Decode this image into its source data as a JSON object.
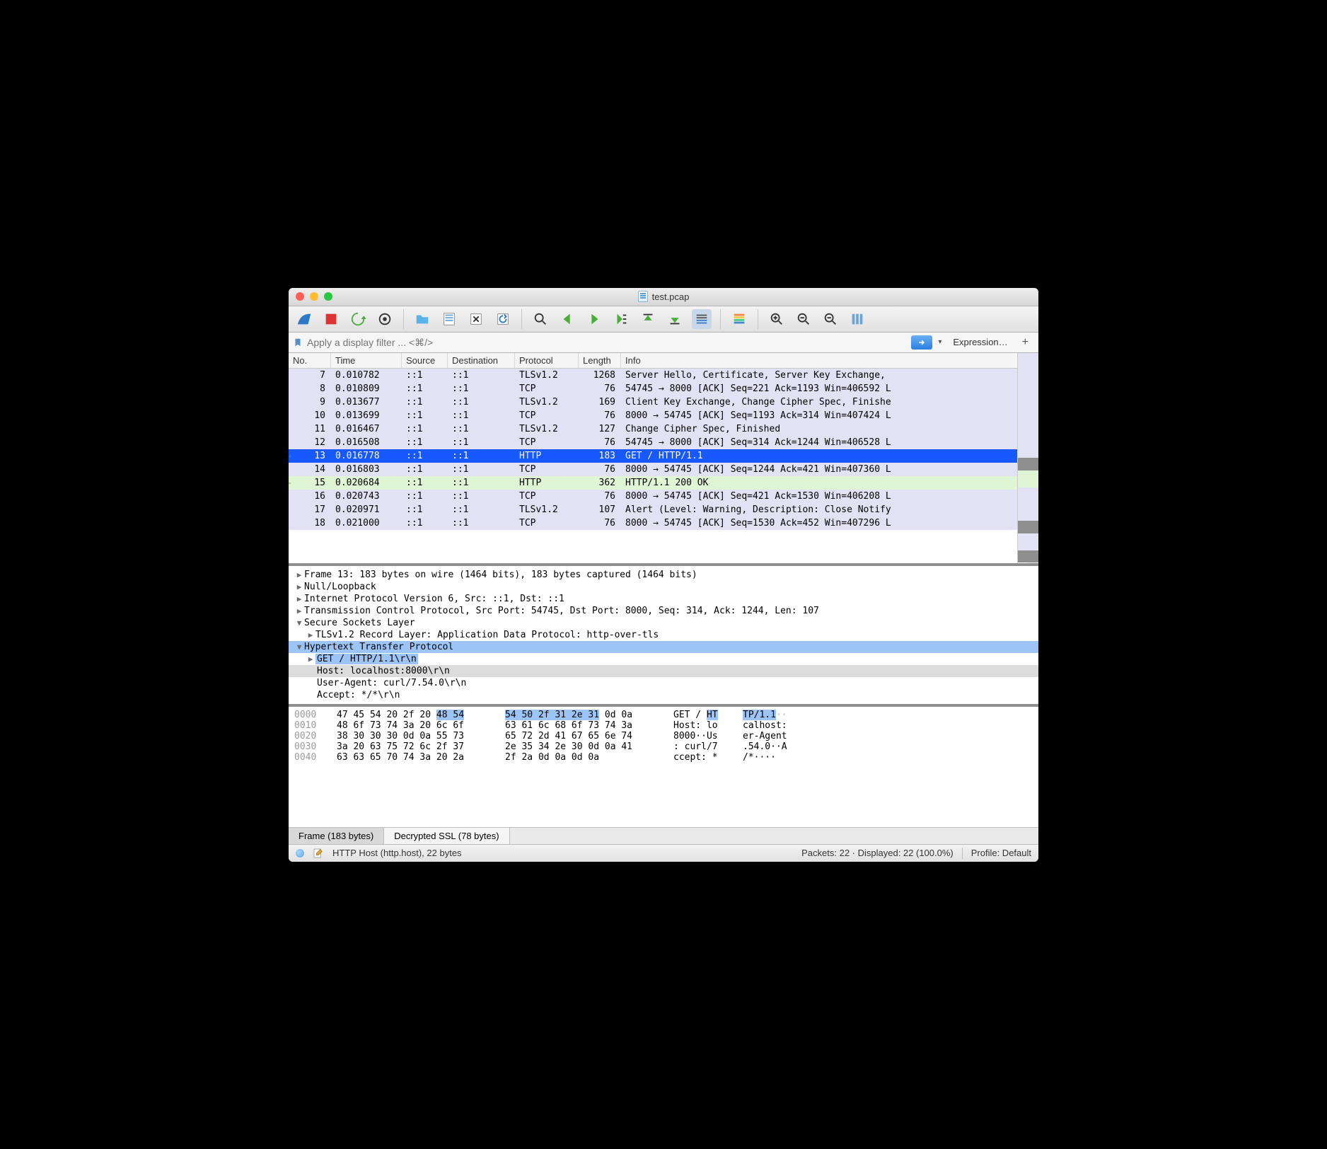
{
  "title": "test.pcap",
  "filter": {
    "placeholder": "Apply a display filter ... <⌘/>"
  },
  "expression_label": "Expression…",
  "columns": {
    "no": "No.",
    "time": "Time",
    "src": "Source",
    "dst": "Destination",
    "proto": "Protocol",
    "len": "Length",
    "info": "Info"
  },
  "packets": [
    {
      "no": "7",
      "time": "0.010782",
      "src": "::1",
      "dst": "::1",
      "proto": "TLSv1.2",
      "len": "1268",
      "info": "Server Hello, Certificate, Server Key Exchange,",
      "cls": "purple"
    },
    {
      "no": "8",
      "time": "0.010809",
      "src": "::1",
      "dst": "::1",
      "proto": "TCP",
      "len": "76",
      "info": "54745 → 8000 [ACK] Seq=221 Ack=1193 Win=406592 L",
      "cls": "purple"
    },
    {
      "no": "9",
      "time": "0.013677",
      "src": "::1",
      "dst": "::1",
      "proto": "TLSv1.2",
      "len": "169",
      "info": "Client Key Exchange, Change Cipher Spec, Finishe",
      "cls": "purple"
    },
    {
      "no": "10",
      "time": "0.013699",
      "src": "::1",
      "dst": "::1",
      "proto": "TCP",
      "len": "76",
      "info": "8000 → 54745 [ACK] Seq=1193 Ack=314 Win=407424 L",
      "cls": "purple"
    },
    {
      "no": "11",
      "time": "0.016467",
      "src": "::1",
      "dst": "::1",
      "proto": "TLSv1.2",
      "len": "127",
      "info": "Change Cipher Spec, Finished",
      "cls": "purple"
    },
    {
      "no": "12",
      "time": "0.016508",
      "src": "::1",
      "dst": "::1",
      "proto": "TCP",
      "len": "76",
      "info": "54745 → 8000 [ACK] Seq=314 Ack=1244 Win=406528 L",
      "cls": "purple"
    },
    {
      "no": "13",
      "time": "0.016778",
      "src": "::1",
      "dst": "::1",
      "proto": "HTTP",
      "len": "183",
      "info": "GET / HTTP/1.1",
      "cls": "selected",
      "arrow": "blue"
    },
    {
      "no": "14",
      "time": "0.016803",
      "src": "::1",
      "dst": "::1",
      "proto": "TCP",
      "len": "76",
      "info": "8000 → 54745 [ACK] Seq=1244 Ack=421 Win=407360 L",
      "cls": "purple"
    },
    {
      "no": "15",
      "time": "0.020684",
      "src": "::1",
      "dst": "::1",
      "proto": "HTTP",
      "len": "362",
      "info": "HTTP/1.1 200 OK",
      "cls": "green",
      "arrow": "green"
    },
    {
      "no": "16",
      "time": "0.020743",
      "src": "::1",
      "dst": "::1",
      "proto": "TCP",
      "len": "76",
      "info": "8000 → 54745 [ACK] Seq=421 Ack=1530 Win=406208 L",
      "cls": "purple"
    },
    {
      "no": "17",
      "time": "0.020971",
      "src": "::1",
      "dst": "::1",
      "proto": "TLSv1.2",
      "len": "107",
      "info": "Alert (Level: Warning, Description: Close Notify",
      "cls": "purple"
    },
    {
      "no": "18",
      "time": "0.021000",
      "src": "::1",
      "dst": "::1",
      "proto": "TCP",
      "len": "76",
      "info": "8000 → 54745 [ACK] Seq=1530 Ack=452 Win=407296 L",
      "cls": "purple"
    }
  ],
  "details": {
    "frame": "Frame 13: 183 bytes on wire (1464 bits), 183 bytes captured (1464 bits)",
    "null": "Null/Loopback",
    "ipv6": "Internet Protocol Version 6, Src: ::1, Dst: ::1",
    "tcp": "Transmission Control Protocol, Src Port: 54745, Dst Port: 8000, Seq: 314, Ack: 1244, Len: 107",
    "ssl": "Secure Sockets Layer",
    "tls_record": "TLSv1.2 Record Layer: Application Data Protocol: http-over-tls",
    "http": "Hypertext Transfer Protocol",
    "get": "GET / HTTP/1.1\\r\\n",
    "host": "Host: localhost:8000\\r\\n",
    "ua": "User-Agent: curl/7.54.0\\r\\n",
    "accept": "Accept: */*\\r\\n"
  },
  "hex": {
    "r0": {
      "off": "0000",
      "b1a": "47 45 54 20 2f 20 ",
      "b1b": "48 54",
      "b2a": "54 50 2f 31 2e 31",
      "b2b": " 0d 0a",
      "a1a": "GET / ",
      "a1b": "HT",
      "a2a": "TP/1.1",
      "a2b": "··"
    },
    "r1": {
      "off": "0010",
      "b1": "48 6f 73 74 3a 20 6c 6f",
      "b2": "63 61 6c 68 6f 73 74 3a",
      "a1": "Host: lo",
      "a2": "calhost:"
    },
    "r2": {
      "off": "0020",
      "b1": "38 30 30 30 0d 0a 55 73",
      "b2": "65 72 2d 41 67 65 6e 74",
      "a1": "8000··Us",
      "a2": "er-Agent"
    },
    "r3": {
      "off": "0030",
      "b1": "3a 20 63 75 72 6c 2f 37",
      "b2": "2e 35 34 2e 30 0d 0a 41",
      "a1": ": curl/7",
      "a2": ".54.0··A"
    },
    "r4": {
      "off": "0040",
      "b1": "63 63 65 70 74 3a 20 2a",
      "b2": "2f 2a 0d 0a 0d 0a",
      "a1": "ccept: *",
      "a2": "/*····"
    }
  },
  "tabs": {
    "frame": "Frame (183 bytes)",
    "ssl": "Decrypted SSL (78 bytes)"
  },
  "status": {
    "field": "HTTP Host (http.host), 22 bytes",
    "packets": "Packets: 22 · Displayed: 22 (100.0%)",
    "profile": "Profile: Default"
  }
}
